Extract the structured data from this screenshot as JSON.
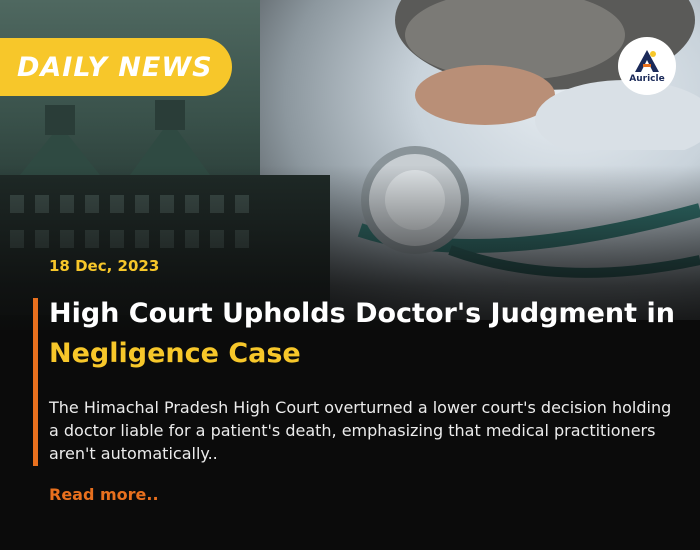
{
  "badge": {
    "label": "DAILY NEWS"
  },
  "logo": {
    "name": "Auricle",
    "icon": "auricle-logo-icon"
  },
  "article": {
    "date": "18 Dec, 2023",
    "headline_part1": "High Court Upholds Doctor's Judgment in ",
    "headline_highlight": "Negligence Case",
    "summary": "The Himachal Pradesh High Court overturned a lower court's decision holding a doctor liable for a patient's death, emphasizing that medical practitioners aren't automatically..",
    "read_more": "Read more.."
  },
  "colors": {
    "accent_yellow": "#f7c72a",
    "accent_orange": "#e8701e",
    "background": "#0b0b0b",
    "logo_navy": "#1b2a59"
  }
}
